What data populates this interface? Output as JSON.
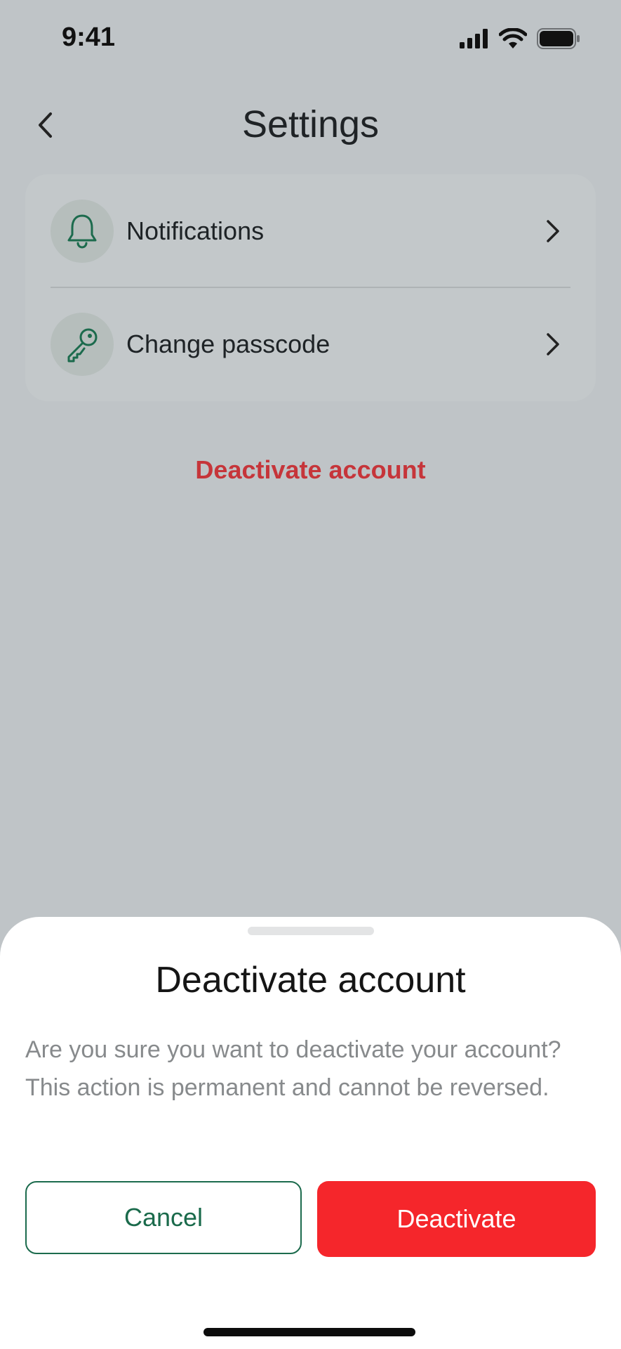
{
  "status_bar": {
    "time": "9:41"
  },
  "header": {
    "title": "Settings"
  },
  "settings": {
    "items": [
      {
        "label": "Notifications",
        "icon": "bell-icon"
      },
      {
        "label": "Change passcode",
        "icon": "key-icon"
      }
    ]
  },
  "deactivate_link": "Deactivate account",
  "sheet": {
    "title": "Deactivate account",
    "body": "Are you sure you want to deactivate your account? This action is permanent and cannot be reversed.",
    "cancel_label": "Cancel",
    "confirm_label": "Deactivate"
  },
  "colors": {
    "accent_green": "#1a6a4b",
    "danger_red": "#f5262b",
    "link_red": "#c6353a",
    "overlay": "#bfc4c7"
  }
}
